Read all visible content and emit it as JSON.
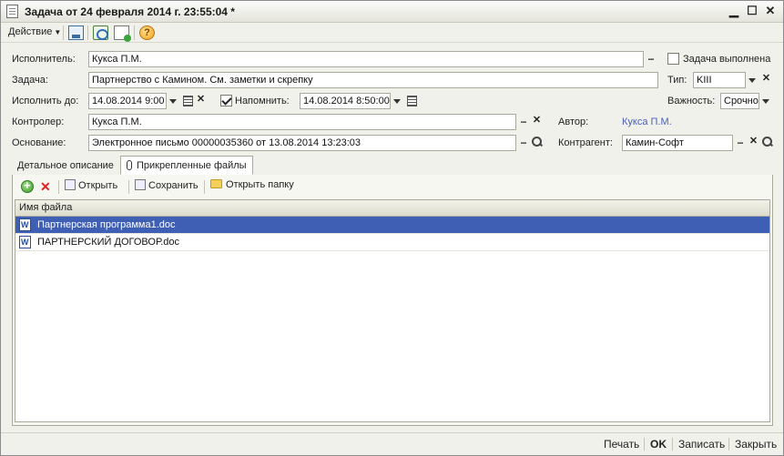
{
  "window": {
    "title": "Задача от 24 февраля 2014 г. 23:55:04 *"
  },
  "toolbar": {
    "action_label": "Действие"
  },
  "form": {
    "executor_label": "Исполнитель:",
    "executor_value": "Кукса П.М.",
    "task_done_label": "Задача выполнена",
    "task_done_checked": false,
    "task_label": "Задача:",
    "task_value": "Партнерство с Камином. См. заметки и скрепку",
    "type_label": "Тип:",
    "type_value": "KIII",
    "due_label": "Исполнить до:",
    "due_value": "14.08.2014  9:00",
    "remind_label": "Напомнить:",
    "remind_checked": true,
    "remind_value": "14.08.2014  8:50:00",
    "importance_label": "Важность:",
    "importance_value": "Срочно",
    "controller_label": "Контролер:",
    "controller_value": "Кукса П.М.",
    "author_label": "Автор:",
    "author_value": "Кукса П.М.",
    "basis_label": "Основание:",
    "basis_value": "Электронное письмо 00000035360 от 13.08.2014 13:23:03",
    "counterparty_label": "Контрагент:",
    "counterparty_value": "Камин-Софт"
  },
  "tabs": [
    {
      "label": "Детальное описание"
    },
    {
      "label": "Прикрепленные файлы"
    }
  ],
  "files_toolbar": {
    "open_label": "Открыть",
    "save_label": "Сохранить",
    "open_folder_label": "Открыть папку"
  },
  "files_table": {
    "column": "Имя файла",
    "rows": [
      {
        "name": "Партнерская программа1.doc"
      },
      {
        "name": "ПАРТНЕРСКИЙ ДОГОВОР.doc"
      }
    ]
  },
  "footer": {
    "print_label": "Печать",
    "ok_label": "OK",
    "write_label": "Записать",
    "close_label": "Закрыть"
  }
}
